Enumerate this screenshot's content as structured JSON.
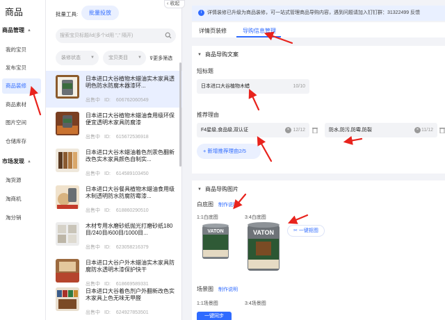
{
  "nav": {
    "title": "商品",
    "groups": [
      {
        "label": "商品管理",
        "items": [
          "我的宝贝",
          "发布宝贝",
          "商品装修",
          "商品素材",
          "图片空间",
          "仓储库存"
        ]
      },
      {
        "label": "市场发现",
        "items": [
          "淘货源",
          "淘商机",
          "淘分销"
        ]
      }
    ],
    "active_item": "商品装修"
  },
  "list": {
    "tool_label": "批量工具:",
    "batch_button": "批量投放",
    "search_placeholder": "搜索宝贝标题/id(多个id用 \",\" 隔开)",
    "filters": [
      "装修状态",
      "宝贝类目"
    ],
    "more_filter": "更多筛选",
    "status_label": "出售中",
    "id_prefix": "ID:",
    "products": [
      {
        "title": "日本进口大谷植物木蜡油实木家具透明色防水防腐木器漆环...",
        "id": "606762060549"
      },
      {
        "title": "日本进口大谷植物木蜡油食用级环保便宜透明木家具防腐漆",
        "id": "615672536918"
      },
      {
        "title": "日本进口大谷木蜡油着色剂汞色翻新改色实木家具颜色自制实...",
        "id": "614589103450"
      },
      {
        "title": "日本进口大谷餐具植物木蜡油食用级木制透明防水防腐防霉漆...",
        "id": "618860290510"
      },
      {
        "title": "木材专用水磨砂纸抛光打磨砂纸180目/240目/600目/1000目...",
        "id": "623058216379"
      },
      {
        "title": "日本进口大谷户外木蜡油实木家具防腐防水透明木漆保护快干",
        "id": "618669589331"
      },
      {
        "title": "日本进口大谷着色剂户外翻新改色实木家具上色无味无甲醛",
        "id": "624927853501"
      }
    ]
  },
  "collapse_label": "收起",
  "notice": "详情装修已升级为商品装修，可一站式管理商品导购内容，遇到问题请加入钉钉群：31322499 反馈",
  "tabs": [
    "详情页装修",
    "导购信息管理"
  ],
  "active_tab": "导购信息管理",
  "copy_section": {
    "title": "商品导购文案",
    "short_title_label": "短标题",
    "short_title_value": "日本进口大谷植物木蜡",
    "short_title_count": "10/10",
    "reason_label": "推荐理由",
    "reasons": [
      {
        "value": "F4星级,食品级,双认证",
        "count": "12/12"
      },
      {
        "value": "防水,防污,防霉,防裂",
        "count": "11/12"
      }
    ],
    "add_reason": "+ 新增推荐理由2/5"
  },
  "image_section": {
    "title": "商品导购图片",
    "white_bg_label": "白底图",
    "white_bg_link": "制作说明",
    "ratio_1_1_white": "1:1白底图",
    "ratio_3_4_white": "3:4白底图",
    "onekey_cutout": "一键抠图",
    "scene_label": "场景图",
    "scene_link": "制作说明",
    "ratio_1_1_scene": "1:1场景图",
    "ratio_3_4_scene": "3:4场景图",
    "onekey_sync": "一键同步",
    "brand_text": "VATON"
  },
  "colors": {
    "accent": "#2f6bff",
    "annotation": "#e8231d"
  }
}
